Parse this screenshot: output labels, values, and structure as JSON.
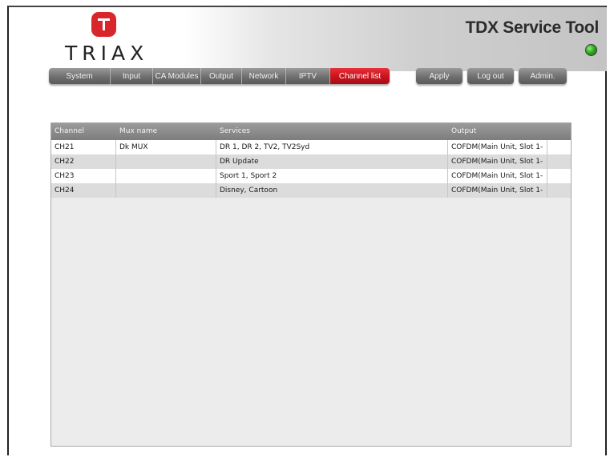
{
  "brand": {
    "logo_text": "TRIAX",
    "logo_color": "#d8262b"
  },
  "header": {
    "app_title": "TDX Service Tool",
    "status_led_color": "#2faa22"
  },
  "nav": {
    "tabs": [
      {
        "label": "System"
      },
      {
        "label": "Input"
      },
      {
        "label": "CA Modules"
      },
      {
        "label": "Output"
      },
      {
        "label": "Network"
      },
      {
        "label": "IPTV"
      },
      {
        "label": "Channel list",
        "active": true
      }
    ],
    "actions": [
      {
        "label": "Apply"
      },
      {
        "label": "Log out"
      },
      {
        "label": "Admin."
      }
    ]
  },
  "table": {
    "columns": [
      "Channel",
      "Mux name",
      "Services",
      "Output"
    ],
    "rows": [
      {
        "channel": "CH21",
        "mux": "Dk MUX",
        "services": "DR 1, DR 2, TV2, TV2Syd",
        "output": "COFDM(Main Unit, Slot 1-"
      },
      {
        "channel": "CH22",
        "mux": "",
        "services": "DR Update",
        "output": "COFDM(Main Unit, Slot 1-"
      },
      {
        "channel": "CH23",
        "mux": "",
        "services": "Sport 1, Sport 2",
        "output": "COFDM(Main Unit, Slot 1-"
      },
      {
        "channel": "CH24",
        "mux": "",
        "services": "Disney, Cartoon",
        "output": "COFDM(Main Unit, Slot 1-"
      }
    ]
  }
}
